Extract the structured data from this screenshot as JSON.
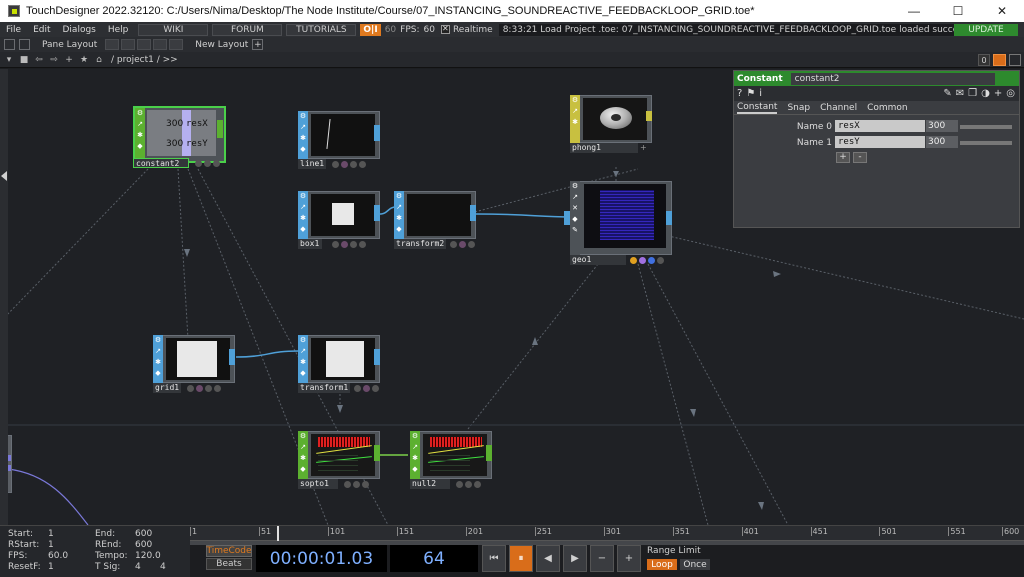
{
  "window": {
    "title": "TouchDesigner 2022.32120: C:/Users/Nima/Desktop/The Node Institute/Course/07_INSTANCING_SOUNDREACTIVE_FEEDBACKLOOP_GRID.toe*",
    "minimize": "—",
    "maximize": "☐",
    "close": "✕"
  },
  "menubar": {
    "items": [
      "File",
      "Edit",
      "Dialogs",
      "Help"
    ],
    "wiki": "WIKI",
    "forum": "FORUM",
    "tutorials": "TUTORIALS",
    "oi": "O|I",
    "sixty": "60",
    "fps_label": "FPS:",
    "fps_value": "60",
    "realtime": "Realtime",
    "status": "8:33:21 Load Project .toe: 07_INSTANCING_SOUNDREACTIVE_FEEDBACKLOOP_GRID.toe loaded successfully.",
    "update": "UPDATE"
  },
  "panebar": {
    "pane_layout": "Pane Layout",
    "new_layout": "New Layout",
    "plus": "+"
  },
  "pathbar": {
    "path": "/ project1 / >>",
    "zero": "0"
  },
  "nodes": {
    "constant2": {
      "name": "constant2",
      "val1": "300",
      "lbl1": "resX",
      "val2": "300",
      "lbl2": "resY"
    },
    "line1": {
      "name": "line1"
    },
    "box1": {
      "name": "box1"
    },
    "transform2": {
      "name": "transform2"
    },
    "phong1": {
      "name": "phong1"
    },
    "geo1": {
      "name": "geo1"
    },
    "grid1": {
      "name": "grid1"
    },
    "transform1": {
      "name": "transform1"
    },
    "sopto1": {
      "name": "sopto1"
    },
    "null2": {
      "name": "null2"
    }
  },
  "params": {
    "type": "Constant",
    "name": "constant2",
    "tabs": [
      "Constant",
      "Snap",
      "Channel",
      "Common"
    ],
    "rows": [
      {
        "label": "Name 0",
        "name": "resX",
        "value": "300"
      },
      {
        "label": "Name 1",
        "name": "resY",
        "value": "300"
      }
    ],
    "add": "+",
    "remove": "-"
  },
  "timeline": {
    "start_label": "Start:",
    "start": "1",
    "rstart_label": "RStart:",
    "rstart": "1",
    "fps_label": "FPS:",
    "fps": "60.0",
    "resetf_label": "ResetF:",
    "resetf": "1",
    "end_label": "End:",
    "end": "600",
    "rend_label": "REnd:",
    "rend": "600",
    "tempo_label": "Tempo:",
    "tempo": "120.0",
    "tsig_label": "T Sig:",
    "tsig_a": "4",
    "tsig_b": "4",
    "ticks": [
      "1",
      "51",
      "101",
      "151",
      "201",
      "251",
      "301",
      "351",
      "401",
      "451",
      "501",
      "551",
      "600"
    ],
    "timecode": "TimeCode",
    "beats": "Beats",
    "time": "00:00:01.03",
    "frame": "64",
    "range_limit": "Range Limit",
    "loop": "Loop",
    "once": "Once"
  },
  "colors": {
    "top_blue": "#4fa0d8",
    "chop_green": "#5cb030",
    "mat_yellow": "#c8c040",
    "accent_orange": "#d96d1a",
    "param_green": "#2d8a2d"
  }
}
